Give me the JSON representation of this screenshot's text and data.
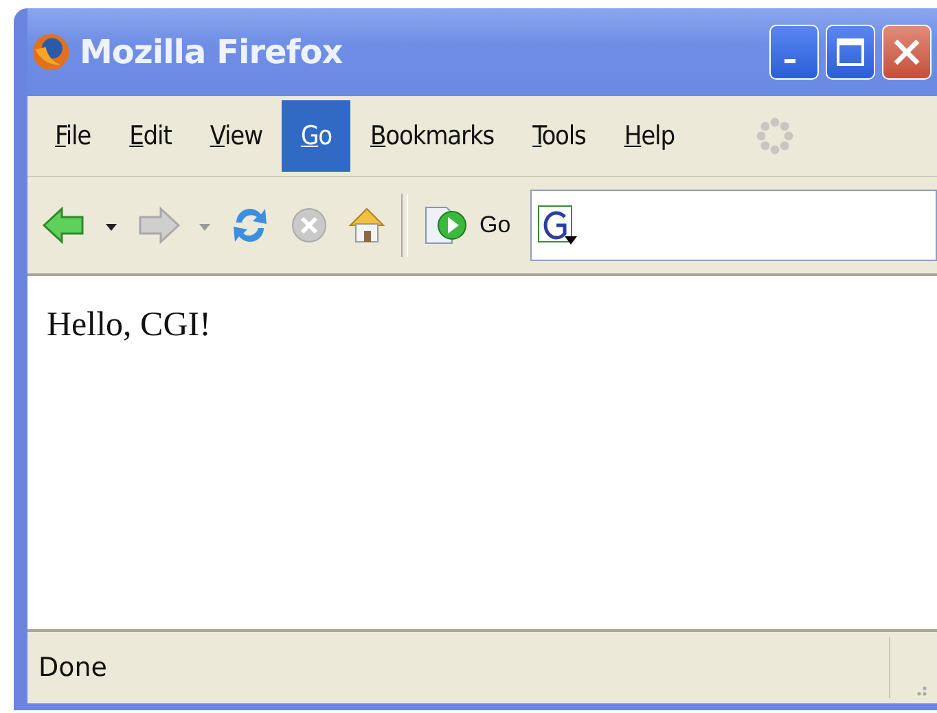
{
  "window": {
    "title": "Mozilla Firefox"
  },
  "menu": [
    {
      "label": "File",
      "selected": false
    },
    {
      "label": "Edit",
      "selected": false
    },
    {
      "label": "View",
      "selected": false
    },
    {
      "label": "Go",
      "selected": true
    },
    {
      "label": "Bookmarks",
      "selected": false
    },
    {
      "label": "Tools",
      "selected": false
    },
    {
      "label": "Help",
      "selected": false
    }
  ],
  "toolbar": {
    "nav_buttons": [
      {
        "kind": "back",
        "disabled": false
      },
      {
        "kind": "forward",
        "disabled": true
      }
    ],
    "go_label": "Go"
  },
  "content": {
    "text": "Hello, CGI!"
  },
  "status_bar": {
    "text": "Done"
  }
}
